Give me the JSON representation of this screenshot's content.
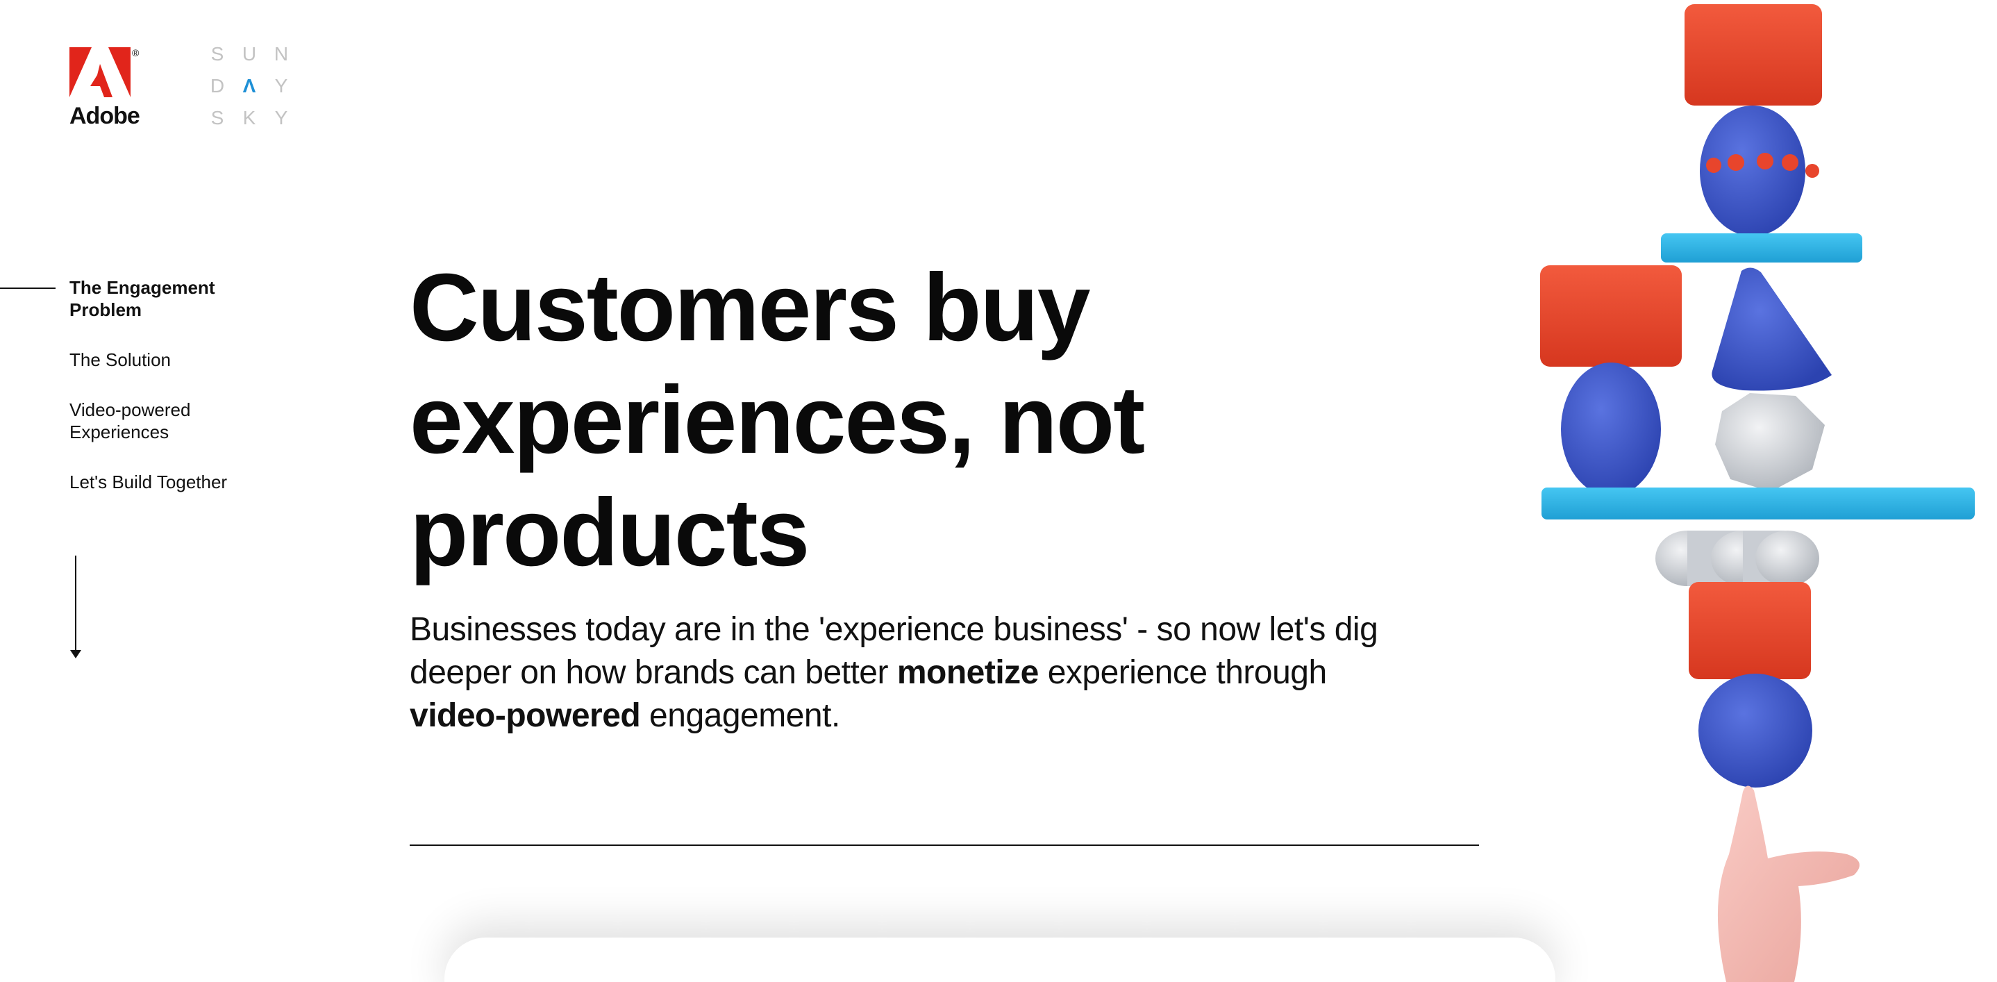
{
  "brand": {
    "adobe_text": "Adobe",
    "adobe_reg": "®",
    "sundaysky_letters": [
      "S",
      "U",
      "N",
      "D",
      "Λ",
      "Y",
      "S",
      "K",
      "Y"
    ],
    "accent_color": "#e1251b",
    "sundaysky_accent": "#1e90d6"
  },
  "nav": {
    "items": [
      {
        "label": "The Engagement Problem",
        "active": true
      },
      {
        "label": "The Solution",
        "active": false
      },
      {
        "label": "Video-powered Experiences",
        "active": false
      },
      {
        "label": "Let's Build Together",
        "active": false
      }
    ],
    "scroll_icon": "arrow-down-icon"
  },
  "hero": {
    "headline_line1": "Customers buy",
    "headline_line2": "experiences, not",
    "headline_line3": "products",
    "sub_part1": "Businesses today are in the 'experience business' - so now let's dig deeper on how brands can better ",
    "sub_bold1": "monetize",
    "sub_part2": " experience through ",
    "sub_bold2": "video-powered",
    "sub_part3": " engagement."
  },
  "illustration": {
    "icon": "balancing-blocks-illustration",
    "colors": {
      "red": "#e8452c",
      "blue": "#3b55c9",
      "cyan": "#2bb4e6",
      "gray": "#cfd2d6",
      "skin": "#f4b8b2"
    }
  }
}
